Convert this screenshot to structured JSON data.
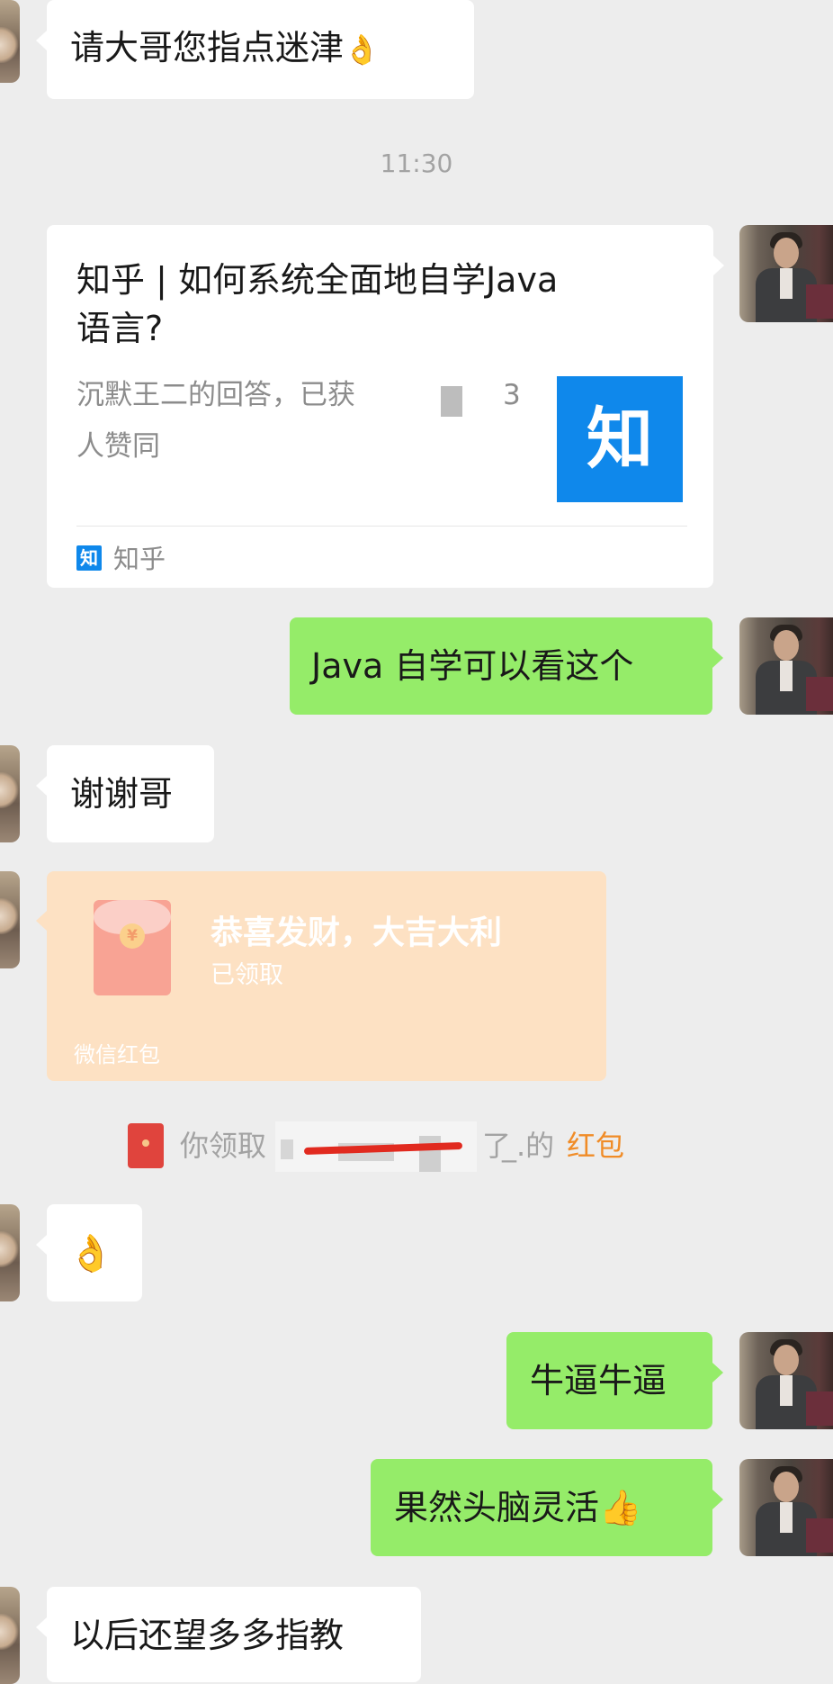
{
  "colors": {
    "background": "#ededed",
    "bubble_green": "#95ec69",
    "bubble_white": "#ffffff",
    "timestamp_text": "#a3a3a3",
    "zhihu_blue": "#0f88eb",
    "red_packet_bg": "#fde1c3",
    "red_packet_link": "#f08c27"
  },
  "messages": [
    {
      "side": "left",
      "text": "请大哥您指点迷津",
      "emoji": "👌"
    },
    {
      "type": "timestamp",
      "text": "11:30"
    },
    {
      "side": "right",
      "type": "link_card",
      "title": "知乎 | 如何系统全面地自学Java语言?",
      "title_line1": "知乎 | 如何系统全面地自学Java",
      "title_line2": "语言?",
      "desc_line1": "沉默王二的回答，已获",
      "desc_partial": "3",
      "desc_line2": "人赞同",
      "thumb_glyph": "知",
      "source_icon_glyph": "知",
      "source": "知乎"
    },
    {
      "side": "right",
      "text": "Java 自学可以看这个"
    },
    {
      "side": "left",
      "text": "谢谢哥"
    },
    {
      "side": "left",
      "type": "red_packet",
      "icon": "red-envelope-icon",
      "coin_glyph": "¥",
      "wish": "恭喜发财，大吉大利",
      "status": "已领取",
      "brand": "微信红包"
    },
    {
      "type": "system_notice",
      "icon": "red-envelope-icon",
      "prefix": "你领取",
      "partial": "了",
      "suffix": "_.的",
      "link": "红包"
    },
    {
      "side": "left",
      "emoji": "👌"
    },
    {
      "side": "right",
      "text": "牛逼牛逼"
    },
    {
      "side": "right",
      "text": "果然头脑灵活",
      "emoji": "👍"
    },
    {
      "side": "left",
      "text": "以后还望多多指教"
    }
  ]
}
